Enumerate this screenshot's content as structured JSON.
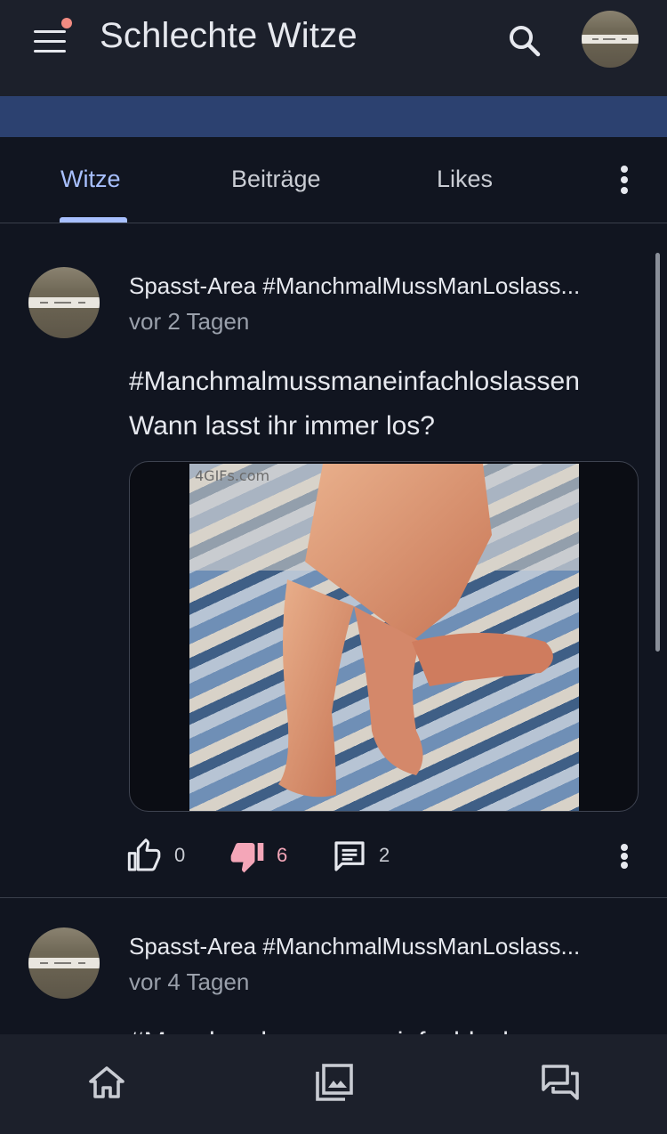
{
  "header": {
    "title": "Schlechte Witze",
    "menu_icon": "menu-icon",
    "notification_dot_color": "#f28b82",
    "search_icon": "search-icon"
  },
  "banner": {
    "color": "#2c4170"
  },
  "tabs": [
    {
      "label": "Witze",
      "active": true
    },
    {
      "label": "Beiträge",
      "active": false
    },
    {
      "label": "Likes",
      "active": false
    }
  ],
  "accent_color": "#a8c0ff",
  "posts": [
    {
      "author": "Spasst-Area #ManchmalMussManLoslass...",
      "time": "vor 2 Tagen",
      "text": "#Manchmalmussmaneinfachloslassen\nWann lasst ihr immer los?",
      "media_watermark": "4GIFs.com",
      "likes": "0",
      "dislikes": "6",
      "comments": "2"
    },
    {
      "author": "Spasst-Area #ManchmalMussManLoslass...",
      "time": "vor 4 Tagen",
      "text": "#Manchmalmussmaneinfachloslassen"
    }
  ],
  "bottom_nav": {
    "items": [
      {
        "icon": "home-icon"
      },
      {
        "icon": "gallery-icon"
      },
      {
        "icon": "forum-icon"
      }
    ]
  }
}
